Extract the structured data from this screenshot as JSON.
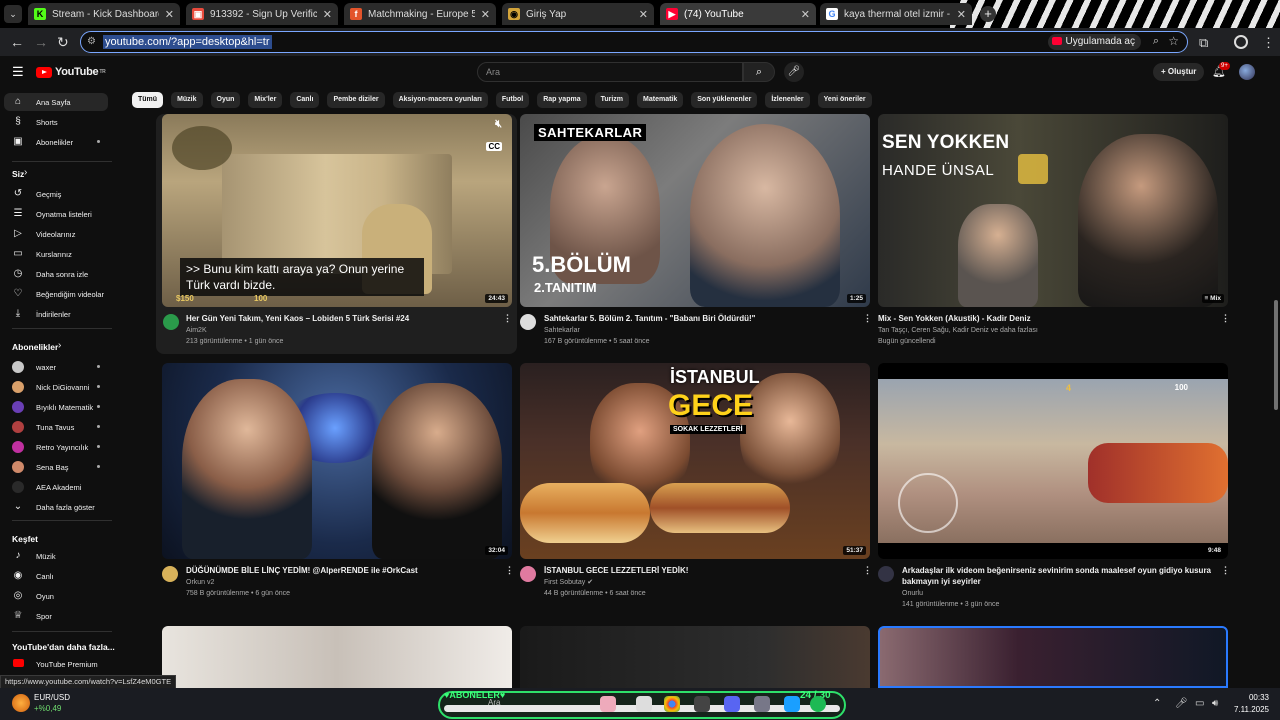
{
  "browser": {
    "tabs": [
      {
        "title": "Stream - Kick Dashboard",
        "color": "#53fc18",
        "glyph": "K"
      },
      {
        "title": "913392 - Sign Up Verification C",
        "color": "#e84a3c",
        "glyph": "▣"
      },
      {
        "title": "Matchmaking - Europe 5v5 Qu",
        "color": "#e3542b",
        "glyph": "f"
      },
      {
        "title": "Giriş Yap",
        "color": "#d3a43a",
        "glyph": "◉"
      },
      {
        "title": "(74) YouTube",
        "color": "#ff0033",
        "glyph": "▶"
      },
      {
        "title": "kaya thermal otel izmir - Goog",
        "color": "#4285f4",
        "glyph": "G"
      }
    ],
    "url": "youtube.com/?app=desktop&hl=tr",
    "open_in_app": "Uygulamada aç"
  },
  "yt": {
    "logo": "YouTube",
    "logo_sup": "TR",
    "search_placeholder": "Ara",
    "create": "Oluştur",
    "notif_count": "9+",
    "chips": [
      "Tümü",
      "Müzik",
      "Oyun",
      "Mix'ler",
      "Canlı",
      "Pembe diziler",
      "Aksiyon-macera oyunları",
      "Futbol",
      "Rap yapma",
      "Turizm",
      "Matematik",
      "Son yüklenenler",
      "İzlenenler",
      "Yeni öneriler"
    ],
    "sidebar": {
      "main": [
        {
          "label": "Ana Sayfa",
          "icon": "home-icon",
          "glyph": "⌂"
        },
        {
          "label": "Shorts",
          "icon": "shorts-icon",
          "glyph": "§"
        },
        {
          "label": "Abonelikler",
          "icon": "subscriptions-icon",
          "glyph": "▣"
        }
      ],
      "you_title": "Siz",
      "you": [
        {
          "label": "Geçmiş",
          "icon": "history-icon",
          "glyph": "↺"
        },
        {
          "label": "Oynatma listeleri",
          "icon": "playlists-icon",
          "glyph": "☰"
        },
        {
          "label": "Videolarınız",
          "icon": "your-videos-icon",
          "glyph": "▷"
        },
        {
          "label": "Kurslarınız",
          "icon": "courses-icon",
          "glyph": "▭"
        },
        {
          "label": "Daha sonra izle",
          "icon": "watch-later-icon",
          "glyph": "◷"
        },
        {
          "label": "Beğendiğim videolar",
          "icon": "liked-icon",
          "glyph": "♡"
        },
        {
          "label": "İndirilenler",
          "icon": "downloads-icon",
          "glyph": "⤓"
        }
      ],
      "subs_title": "Abonelikler",
      "subs": [
        {
          "label": "waxer",
          "color": "#c8c8c8"
        },
        {
          "label": "Nick DiGiovanni",
          "color": "#d9a06a"
        },
        {
          "label": "Bıyıklı Matematik",
          "color": "#6a3fb5"
        },
        {
          "label": "Tuna Tavus",
          "color": "#b04040"
        },
        {
          "label": "Retro Yayıncılık",
          "color": "#c030a0"
        },
        {
          "label": "Sena Baş",
          "color": "#d08a6a"
        },
        {
          "label": "AEA Akademi",
          "color": "#2a2a2a"
        }
      ],
      "show_more": "Daha fazla göster",
      "explore_title": "Keşfet",
      "explore": [
        {
          "label": "Müzik",
          "icon": "music-icon",
          "glyph": "♪"
        },
        {
          "label": "Canlı",
          "icon": "live-icon",
          "glyph": "◉"
        },
        {
          "label": "Oyun",
          "icon": "gaming-icon",
          "glyph": "◎"
        },
        {
          "label": "Spor",
          "icon": "sports-icon",
          "glyph": "♕"
        }
      ],
      "more_title": "YouTube'dan daha fazla...",
      "premium": "YouTube Premium"
    },
    "videos": [
      {
        "title": "Her Gün Yeni Takım, Yeni Kaos – Lobiden 5 Türk Serisi #24",
        "channel": "Aim2K",
        "meta": "213 görüntülenme • 1 gün önce",
        "duration": "24:43",
        "caption": ">> Bunu kim kattı araya ya? Onun yerine Türk vardı bizde.",
        "hud_money": "$150",
        "hud_armor": "100",
        "ch_color": "#2a9a4a"
      },
      {
        "title": "Sahtekarlar 5. Bölüm 2. Tanıtım - \"Babanı Biri Öldürdü!\"",
        "channel": "Sahtekarlar",
        "meta": "167 B görüntülenme • 5 saat önce",
        "duration": "1:25",
        "ov1": "SAHTEKARLAR",
        "ov2": "5.BÖLÜM",
        "ov3": "2.TANITIM",
        "ch_color": "#ddd"
      },
      {
        "title": "Mix - Sen Yokken (Akustik) - Kadir Deniz",
        "channel": "Tan Taşçı, Ceren Sağu, Kadir Deniz ve daha fazlası",
        "meta": "Bugün güncellendi",
        "duration": "Mix",
        "ov1": "SEN YOKKEN",
        "ov2": "HANDE ÜNSAL"
      },
      {
        "title": "DÜĞÜNÜMDE BİLE LİNÇ YEDİM! @AlperRENDE  ile #OrkCast",
        "channel": "Orkun v2",
        "meta": "758 B görüntülenme • 6 gün önce",
        "duration": "32:04",
        "ch_color": "#d8b25a"
      },
      {
        "title": "İSTANBUL GECE LEZZETLERİ YEDİK!",
        "channel": "First Sobutay",
        "meta": "44 B görüntülenme • 6 saat önce",
        "duration": "51:37",
        "ov1": "İSTANBUL",
        "ov2": "GECE",
        "ov3": "SOKAK LEZZETLERİ",
        "ch_color": "#e07aa0"
      },
      {
        "title": "Arkadaşlar ilk videom beğenirseniz sevinirim sonda maalesef oyun gidiyo kusura bakmayın iyi seyirler",
        "channel": "Onurlu",
        "meta": "141 görüntülenme • 3 gün önce",
        "duration": "9:48",
        "hud_hp": "100",
        "hud_ammo": "4",
        "ch_color": "#334"
      }
    ]
  },
  "status_url": "https://www.youtube.com/watch?v=LsfZ4eM0GTE",
  "taskbar": {
    "weather_label": "EUR/USD",
    "weather_value": "+%0,49",
    "center_label": "♥ABONELER♥",
    "counter": "24 / 30",
    "search": "Ara",
    "time": "00:33",
    "date": "7.11.2025"
  }
}
